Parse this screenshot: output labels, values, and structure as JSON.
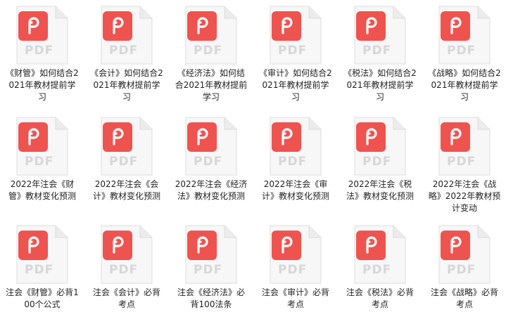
{
  "files": [
    {
      "label": "《财管》如何结合2021年教材提前学习",
      "type_text": "PDF",
      "icon": "pdf-file-icon"
    },
    {
      "label": "《会计》如何结合2021年教材提前学习",
      "type_text": "PDF",
      "icon": "pdf-file-icon"
    },
    {
      "label": "《经济法》如何结合2021年教材提前学习",
      "type_text": "PDF",
      "icon": "pdf-file-icon"
    },
    {
      "label": "《审计》如何结合2021年教材提前学习",
      "type_text": "PDF",
      "icon": "pdf-file-icon"
    },
    {
      "label": "《税法》如何结合2021年教材提前学习",
      "type_text": "PDF",
      "icon": "pdf-file-icon"
    },
    {
      "label": "《战略》如何结合2021年教材提前学习",
      "type_text": "PDF",
      "icon": "pdf-file-icon"
    },
    {
      "label": "2022年注会《财管》教材变化预测",
      "type_text": "PDF",
      "icon": "pdf-file-icon"
    },
    {
      "label": "2022年注会《会计》教材变化预测",
      "type_text": "PDF",
      "icon": "pdf-file-icon"
    },
    {
      "label": "2022年注会《经济法》教材变化预测",
      "type_text": "PDF",
      "icon": "pdf-file-icon"
    },
    {
      "label": "2022年注会《审计》教材变化预测",
      "type_text": "PDF",
      "icon": "pdf-file-icon"
    },
    {
      "label": "2022年注会《税法》教材变化预测",
      "type_text": "PDF",
      "icon": "pdf-file-icon"
    },
    {
      "label": "2022年注会《战略》2022年教材预计变动",
      "type_text": "PDF",
      "icon": "pdf-file-icon"
    },
    {
      "label": "注会《财管》必背100个公式",
      "type_text": "PDF",
      "icon": "pdf-file-icon"
    },
    {
      "label": "注会《会计》必背考点",
      "type_text": "PDF",
      "icon": "pdf-file-icon"
    },
    {
      "label": "注会《经济法》必背100法条",
      "type_text": "PDF",
      "icon": "pdf-file-icon"
    },
    {
      "label": "注会《审计》必背考点",
      "type_text": "PDF",
      "icon": "pdf-file-icon"
    },
    {
      "label": "注会《税法》必背考点",
      "type_text": "PDF",
      "icon": "pdf-file-icon"
    },
    {
      "label": "注会《战略》必背考点",
      "type_text": "PDF",
      "icon": "pdf-file-icon"
    }
  ],
  "colors": {
    "badge": "#ef5350",
    "page": "#f7f7f7",
    "page_border": "#dcdcdc",
    "pdf_text": "#d7d7d7"
  }
}
